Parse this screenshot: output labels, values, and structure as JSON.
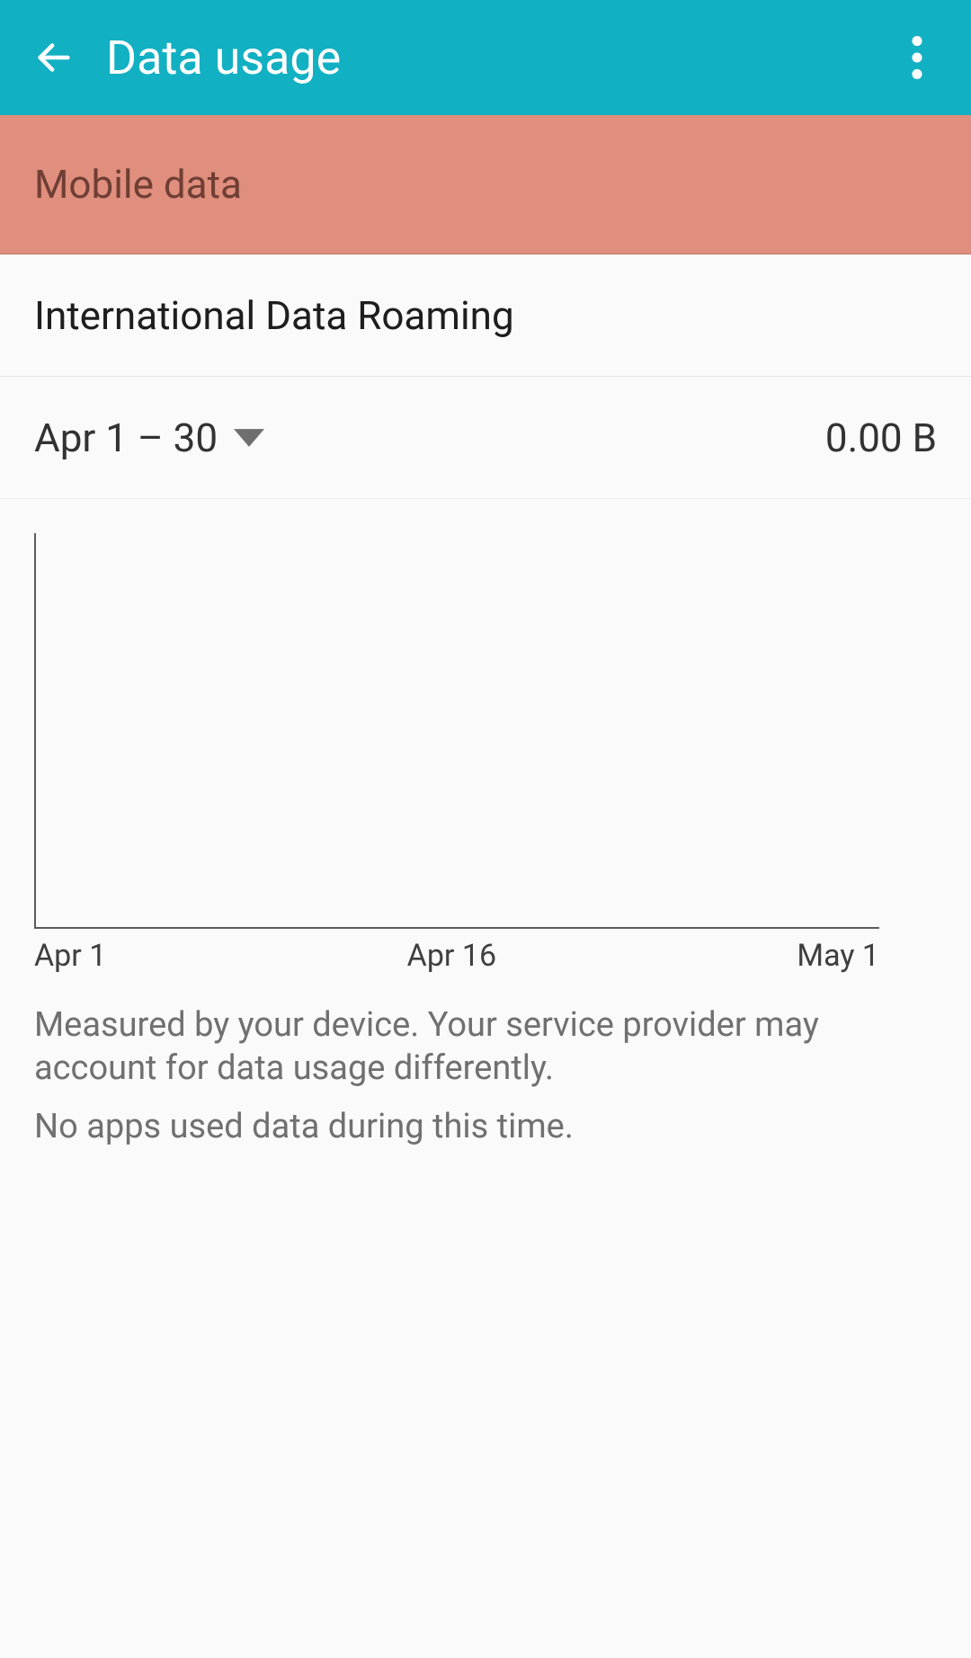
{
  "appbar": {
    "title": "Data usage"
  },
  "tabs": {
    "mobile_data": "Mobile data"
  },
  "rows": {
    "roaming_label": "International Data Roaming"
  },
  "cycle": {
    "range": "Apr 1 – 30",
    "total": "0.00 B"
  },
  "info": {
    "measured": "Measured by your device. Your service provider may account for data usage differently.",
    "no_apps": "No apps used data during this time."
  },
  "chart_data": {
    "type": "line",
    "x": [
      "Apr 1",
      "Apr 16",
      "May 1"
    ],
    "series": [
      {
        "name": "Data usage",
        "values": [
          0,
          0,
          0
        ]
      }
    ],
    "xlabel": "",
    "ylabel": "",
    "ylim": [
      0,
      0
    ],
    "xticks": [
      "Apr 1",
      "Apr 16",
      "May 1"
    ]
  }
}
